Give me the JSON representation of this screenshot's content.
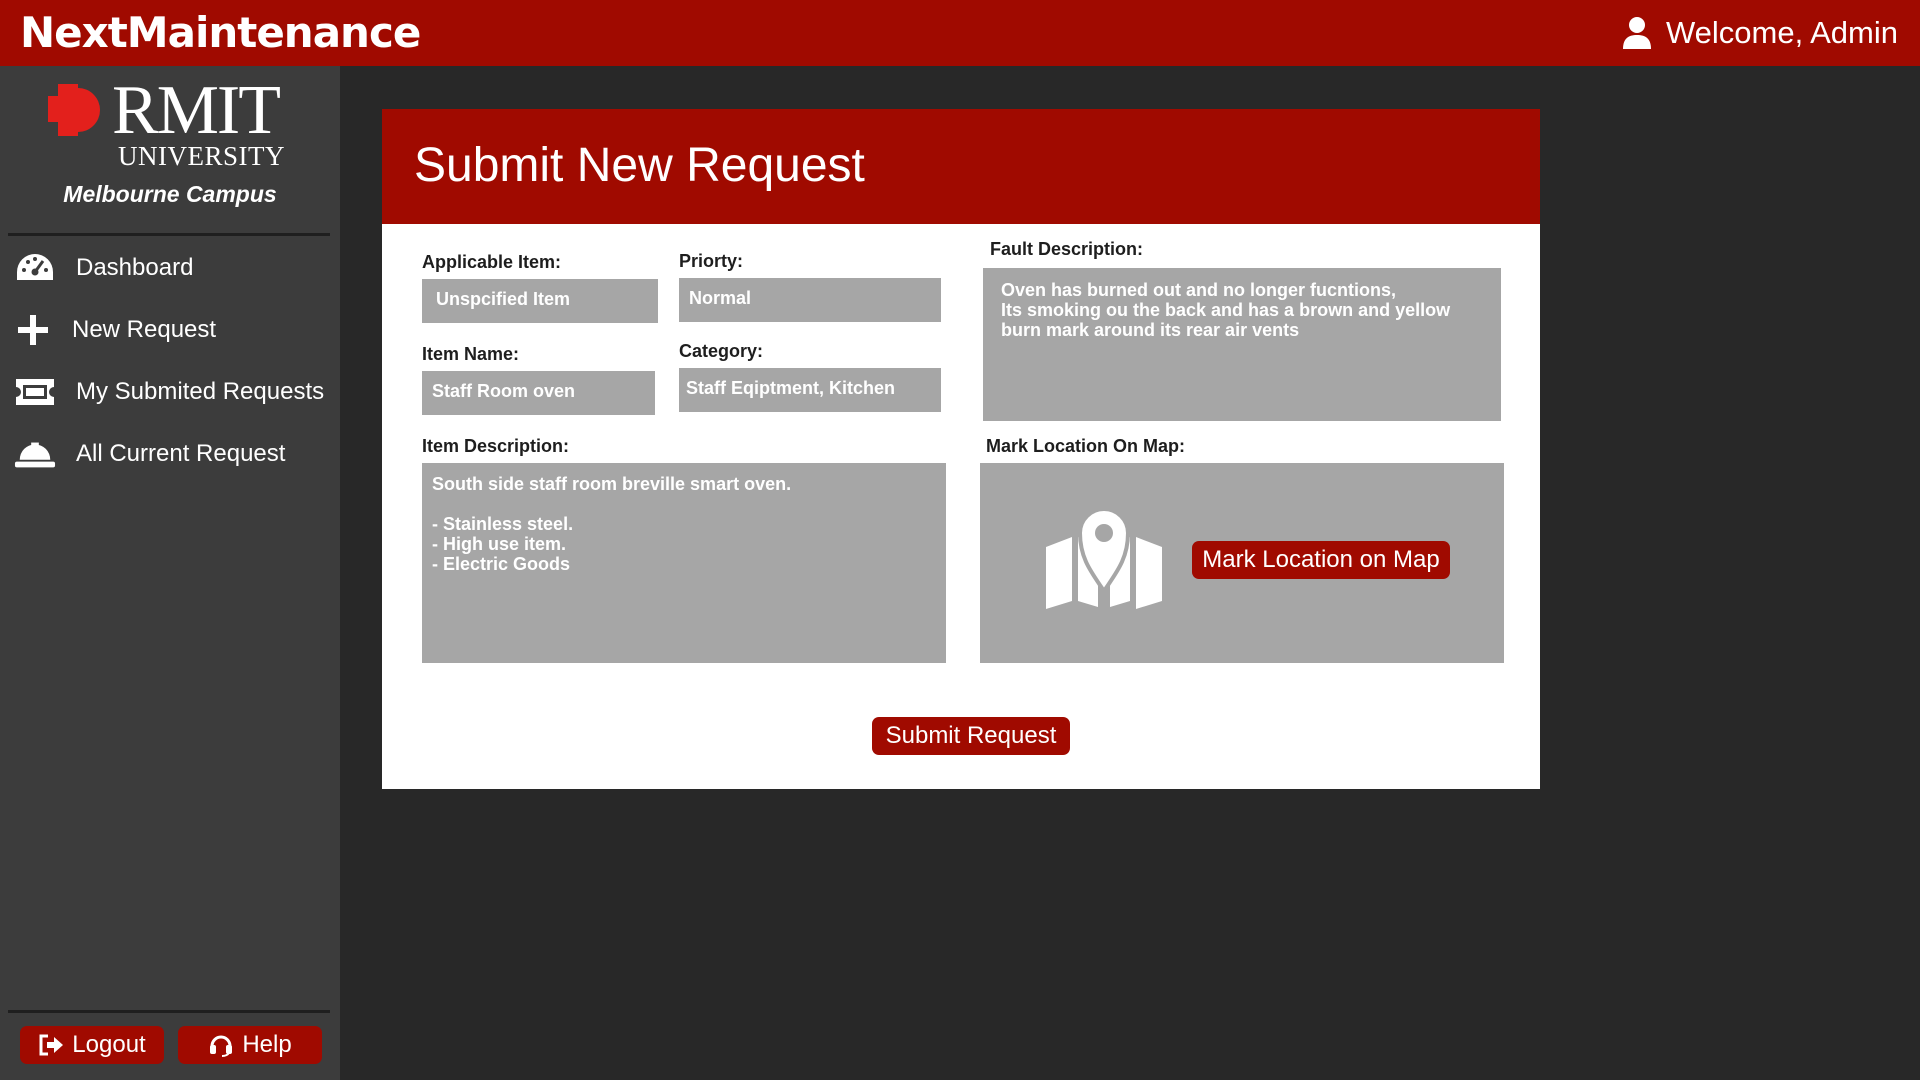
{
  "app": {
    "title": "NextMaintenance",
    "welcome": "Welcome, Admin"
  },
  "sidebar": {
    "logo_text": "RMIT",
    "logo_subtext": "UNIVERSITY",
    "campus": "Melbourne Campus",
    "items": [
      {
        "label": "Dashboard",
        "icon": "dashboard-gauge-icon"
      },
      {
        "label": "New Request",
        "icon": "plus-icon"
      },
      {
        "label": "My Submited Requests",
        "icon": "ticket-icon"
      },
      {
        "label": "All Current Request",
        "icon": "hard-hat-icon"
      }
    ],
    "logout_label": "Logout",
    "help_label": "Help"
  },
  "form": {
    "title": "Submit New Request",
    "applicable_item": {
      "label": "Applicable Item:",
      "value": "Unspcified Item"
    },
    "priority": {
      "label": "Priorty:",
      "value": "Normal"
    },
    "item_name": {
      "label": "Item Name:",
      "value": "Staff Room oven"
    },
    "category": {
      "label": "Category:",
      "value": "Staff Eqiptment, Kitchen"
    },
    "item_description": {
      "label": "Item Description:",
      "value": "South side staff room breville smart oven.\n\n- Stainless steel.\n- High use item.\n- Electric Goods"
    },
    "fault_description": {
      "label": "Fault Description:",
      "value": "Oven has burned out and no longer fucntions,\nIts smoking ou the back and has a brown and yellow\nburn mark around its rear air vents"
    },
    "map": {
      "label": "Mark Location On Map:",
      "button_label": "Mark Location on Map",
      "icon": "map-pin-icon"
    },
    "submit_label": "Submit Request"
  },
  "colors": {
    "accent": "#a00a00",
    "field_bg": "#a6a6a6",
    "sidebar_bg": "#3c3c3c",
    "page_bg": "#282828"
  }
}
